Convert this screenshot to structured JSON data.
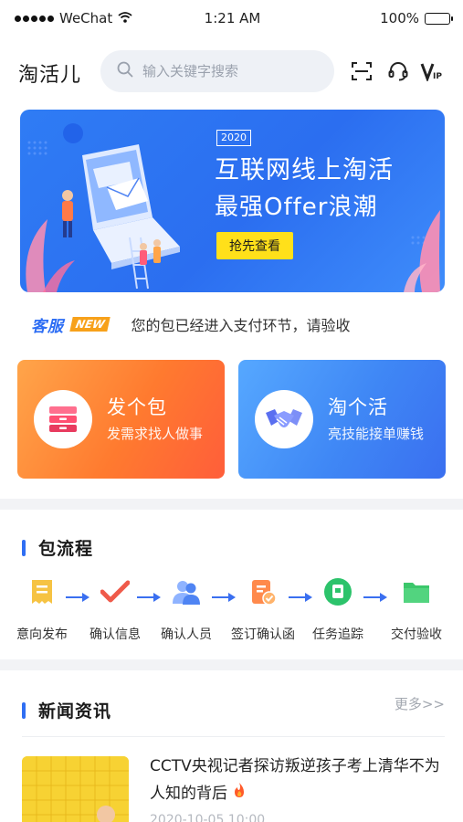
{
  "status_bar": {
    "carrier": "WeChat",
    "time": "1:21 AM",
    "battery": "100%"
  },
  "header": {
    "title": "淘活儿",
    "search_placeholder": "输入关键字搜索",
    "icons": [
      "scan-icon",
      "headset-icon",
      "vip-icon"
    ]
  },
  "banner": {
    "year": "2020",
    "line1": "互联网线上淘活",
    "line2": "最强Offer浪潮",
    "button": "抢先查看"
  },
  "notice": {
    "label": "客服",
    "badge": "NEW",
    "text": "您的包已经进入支付环节，请验收"
  },
  "cards": [
    {
      "title": "发个包",
      "subtitle": "发需求找人做事",
      "icon": "drawer-icon"
    },
    {
      "title": "淘个活",
      "subtitle": "亮技能接单赚钱",
      "icon": "handshake-icon"
    }
  ],
  "process": {
    "title": "包流程",
    "steps": [
      {
        "label": "意向发布",
        "icon": "receipt-icon"
      },
      {
        "label": "确认信息",
        "icon": "check-icon"
      },
      {
        "label": "确认人员",
        "icon": "users-icon"
      },
      {
        "label": "签订确认函",
        "icon": "signed-doc-icon"
      },
      {
        "label": "任务追踪",
        "icon": "tracking-icon"
      },
      {
        "label": "交付验收",
        "icon": "folder-check-icon"
      }
    ]
  },
  "news": {
    "title": "新闻资讯",
    "more": "更多>>",
    "item": {
      "title": "CCTV央视记者探访叛逆孩子考上清华不为人知的背后",
      "date": "2020-10-05 10:00"
    }
  },
  "colors": {
    "primary_blue": "#2f6ef3",
    "orange": "#ff7a2f",
    "notice_badge": "#f7a11a",
    "banner_button": "#ffe01a"
  }
}
